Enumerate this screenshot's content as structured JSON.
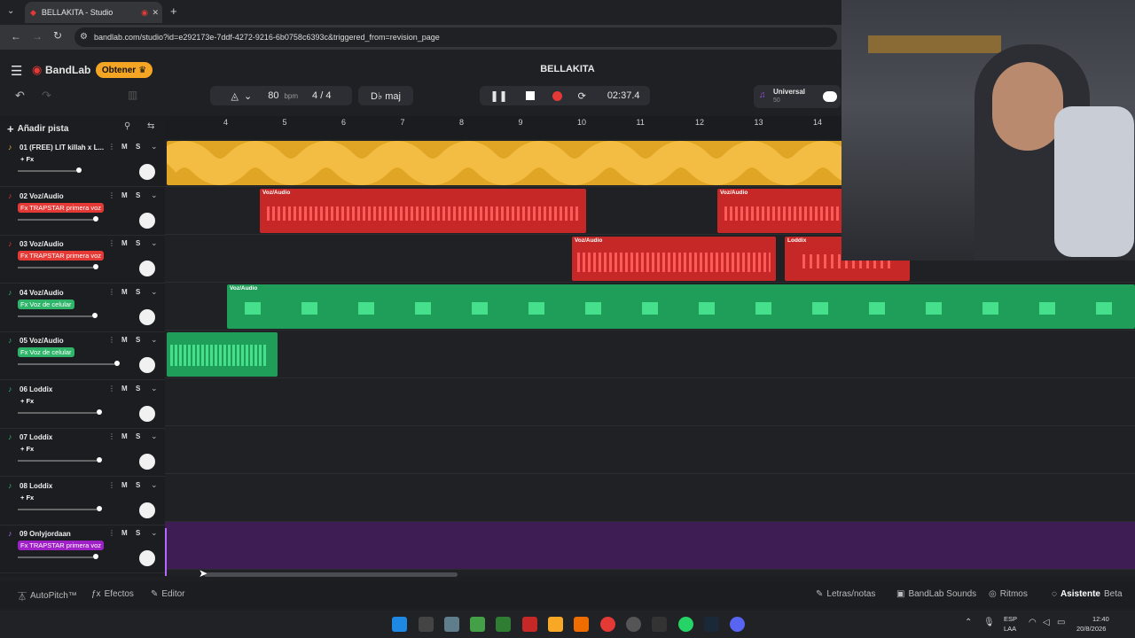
{
  "browser": {
    "tab_title": "BELLAKITA - Studio",
    "url": "bandlab.com/studio?id=e292173e-7ddf-4272-9216-6b0758c6393c&triggered_from=revision_page"
  },
  "header": {
    "brand": "BandLab",
    "get_button": "Obtener",
    "project_title": "BELLAKITA",
    "bpm_value": "80",
    "bpm_unit": "bpm",
    "time_sig": "4 / 4",
    "key": "D♭ maj",
    "time_display": "02:37.4",
    "universal_label": "Universal",
    "universal_sub": "50"
  },
  "add_track_label": "Añadir pista",
  "ruler_ticks": [
    "4",
    "5",
    "6",
    "7",
    "8",
    "9",
    "10",
    "11",
    "12",
    "13",
    "14"
  ],
  "tracks": [
    {
      "name": "01  (FREE) LIT killah x L...",
      "fx": "+ Fx",
      "fx_color": "none",
      "icon_color": "#f0b429",
      "vol": 86
    },
    {
      "name": "02  Voz/Audio",
      "fx": "Fx TRAPSTAR primera voz",
      "fx_color": "#e53935",
      "icon_color": "#e53935",
      "vol": 105
    },
    {
      "name": "03  Voz/Audio",
      "fx": "Fx TRAPSTAR primera voz",
      "fx_color": "#e53935",
      "icon_color": "#e53935",
      "vol": 105
    },
    {
      "name": "04  Voz/Audio",
      "fx": "Fx Voz de celular",
      "fx_color": "#2fb56a",
      "icon_color": "#2fb56a",
      "vol": 104
    },
    {
      "name": "05  Voz/Audio",
      "fx": "Fx Voz de celular",
      "fx_color": "#2fb56a",
      "icon_color": "#2fb56a",
      "vol": 129
    },
    {
      "name": "06  Loddix",
      "fx": "+ Fx",
      "fx_color": "none",
      "icon_color": "#2fb56a",
      "vol": 109
    },
    {
      "name": "07  Loddix",
      "fx": "+ Fx",
      "fx_color": "none",
      "icon_color": "#2fb56a",
      "vol": 109
    },
    {
      "name": "08  Loddix",
      "fx": "+ Fx",
      "fx_color": "none",
      "icon_color": "#2fb56a",
      "vol": 109
    },
    {
      "name": "09  Onlyjordaan",
      "fx": "Fx TRAPSTAR primera voz",
      "fx_color": "#a020c8",
      "icon_color": "#b36bff",
      "vol": 105
    }
  ],
  "clip_labels": {
    "c2a": "Voz/Audio",
    "c2b": "Voz/Audio",
    "c3a": "Voz/Audio",
    "c3b": "Loddix",
    "c4a": "Voz/Audio"
  },
  "ms": {
    "m": "M",
    "s": "S"
  },
  "bottom": {
    "autopitch": "AutoPitch™",
    "effects": "Efectos",
    "editor": "Editor",
    "lyrics": "Letras/notas",
    "sounds": "BandLab Sounds",
    "rhythms": "Ritmos",
    "assistant": "Asistente",
    "beta": "Beta"
  },
  "taskbar": {
    "lang": "ESP",
    "lang2": "LAA",
    "time": "12:40",
    "date": "20/8/2026"
  },
  "colors": {
    "yellow": "#f0b429",
    "red": "#e53935",
    "green": "#2fb56a",
    "purple": "#6d2a9a",
    "accent_orange": "#f5a524"
  }
}
